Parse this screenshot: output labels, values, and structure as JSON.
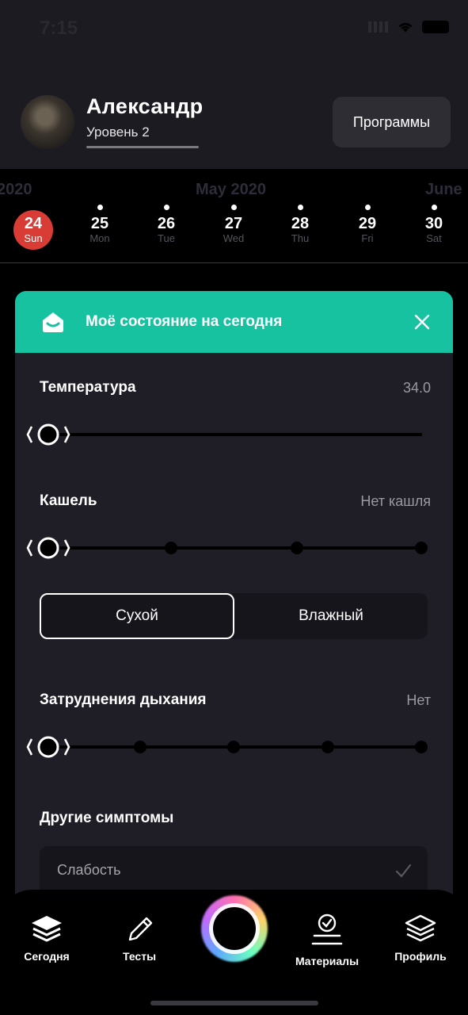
{
  "status_bar": {
    "time": "7:15"
  },
  "header": {
    "user_name": "Александр",
    "level": "Уровень 2",
    "level_progress": 1.0,
    "programs_button": "Программы"
  },
  "calendar": {
    "months": {
      "prev": "2020",
      "current": "May 2020",
      "next": "June"
    },
    "days": [
      {
        "num": "24",
        "weekday": "Sun",
        "selected": true
      },
      {
        "num": "25",
        "weekday": "Mon"
      },
      {
        "num": "26",
        "weekday": "Tue"
      },
      {
        "num": "27",
        "weekday": "Wed"
      },
      {
        "num": "28",
        "weekday": "Thu"
      },
      {
        "num": "29",
        "weekday": "Fri"
      },
      {
        "num": "30",
        "weekday": "Sat"
      }
    ]
  },
  "card": {
    "title": "Моё состояние на сегодня",
    "accent_color": "#17c2a0",
    "temperature": {
      "label": "Температура",
      "value": "34.0",
      "level": 0
    },
    "cough": {
      "label": "Кашель",
      "value": "Нет кашля",
      "level": 0,
      "steps": 4,
      "options": [
        "Сухой",
        "Влажный"
      ],
      "selected": "Сухой"
    },
    "breathing": {
      "label": "Затруднения дыхания",
      "value": "Нет",
      "level": 0,
      "steps": 5
    },
    "other": {
      "label": "Другие симптомы",
      "items": [
        "Слабость"
      ]
    }
  },
  "tabbar": {
    "tabs": [
      {
        "label": "Сегодня",
        "icon": "layers-icon"
      },
      {
        "label": "Тесты",
        "icon": "pencil-icon"
      },
      {
        "label": "Материалы",
        "icon": "badge-check-icon"
      },
      {
        "label": "Профиль",
        "icon": "layers-outline-icon"
      }
    ]
  }
}
